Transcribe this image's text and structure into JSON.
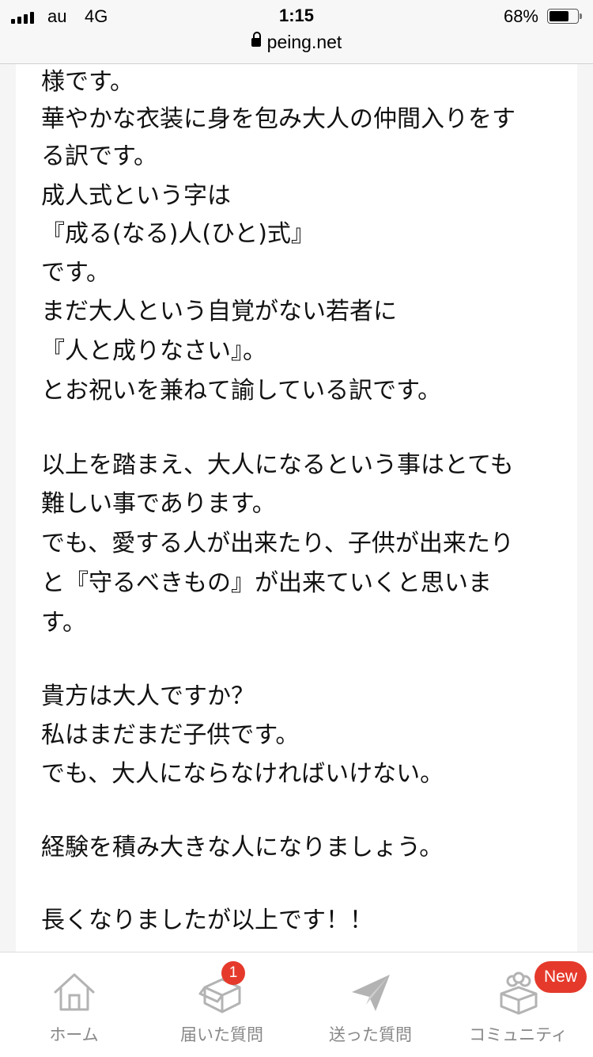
{
  "status_bar": {
    "carrier": "au",
    "network": "4G",
    "time": "1:15",
    "battery": "68%",
    "battery_level": 0.68
  },
  "browser": {
    "url": "peing.net"
  },
  "answer": {
    "lines": [
      "様です。",
      "華やかな衣装に身を包み大人の仲間入りをす",
      "る訳です。",
      "成人式という字は",
      "『成る(なる)人(ひと)式』",
      "です。",
      "まだ大人という自覚がない若者に",
      "『人と成りなさい』。",
      "とお祝いを兼ねて諭している訳です。",
      "",
      "以上を踏まえ、大人になるという事はとても",
      "難しい事であります。",
      "でも、愛する人が出来たり、子供が出来たり",
      "と『守るべきもの』が出来ていくと思いま",
      "す。",
      "",
      "貴方は大人ですか？",
      "私はまだまだ子供です。",
      "でも、大人にならなければいけない。",
      "",
      "経験を積み大きな人になりましょう。",
      "",
      "長くなりましたが以上です！！"
    ]
  },
  "nav": {
    "items": [
      {
        "label": "ホーム",
        "icon": "home-icon"
      },
      {
        "label": "届いた質問",
        "icon": "inbox-box-icon"
      },
      {
        "label": "送った質問",
        "icon": "paper-plane-icon"
      },
      {
        "label": "コミュニティ",
        "icon": "community-box-icon"
      }
    ],
    "inbox_badge": "1",
    "community_badge": "New",
    "badge_color": "#e53a2b",
    "icon_color": "#b3b3b3",
    "label_color": "#888888"
  }
}
